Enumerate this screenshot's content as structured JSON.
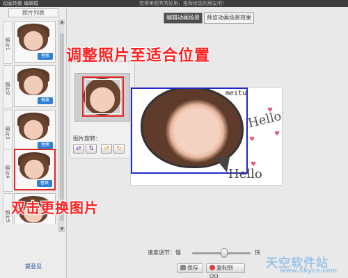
{
  "titlebar": {
    "app_title": "动画场景 编辑框",
    "promo": "觉得美图秀秀好用，推荐给您的朋友吧！"
  },
  "sidebar": {
    "header": "照片列表",
    "photo_label_prefix": "照片",
    "items": [
      {
        "label": "照片1",
        "replace": "替换"
      },
      {
        "label": "照片2",
        "replace": "替换"
      },
      {
        "label": "照片3",
        "replace": "替换"
      },
      {
        "label": "照片4",
        "replace": "替换",
        "selected": true
      },
      {
        "label": "照片5"
      }
    ],
    "feedback": "提意见"
  },
  "tabs": {
    "edit": "编辑动画场景",
    "preview": "预览动画场景效果",
    "active": "edit"
  },
  "rotate_panel": {
    "label": "图片旋转：",
    "buttons": [
      "flip-horizontal-icon",
      "flip-vertical-icon",
      "rotate-left-icon",
      "rotate-right-icon"
    ]
  },
  "canvas": {
    "brand": "meitu",
    "hello_top": "Hello",
    "hello_bottom": "Hello"
  },
  "annotations": {
    "top": "调整照片至适合位置",
    "bottom": "双击更换图片"
  },
  "speed": {
    "label": "速度调节：慢",
    "fast": "快",
    "value_fraction": 0.55
  },
  "buttons": {
    "save": "保存",
    "copy_to_qq": "复制到QQ"
  },
  "watermark": {
    "name": "天空软件站",
    "url": "www.Skycn.com"
  },
  "colors": {
    "annotation": "#ff2020",
    "selection_border": "#e32525",
    "canvas_frame": "#2028c8",
    "replace_button": "#2f7fd6"
  }
}
